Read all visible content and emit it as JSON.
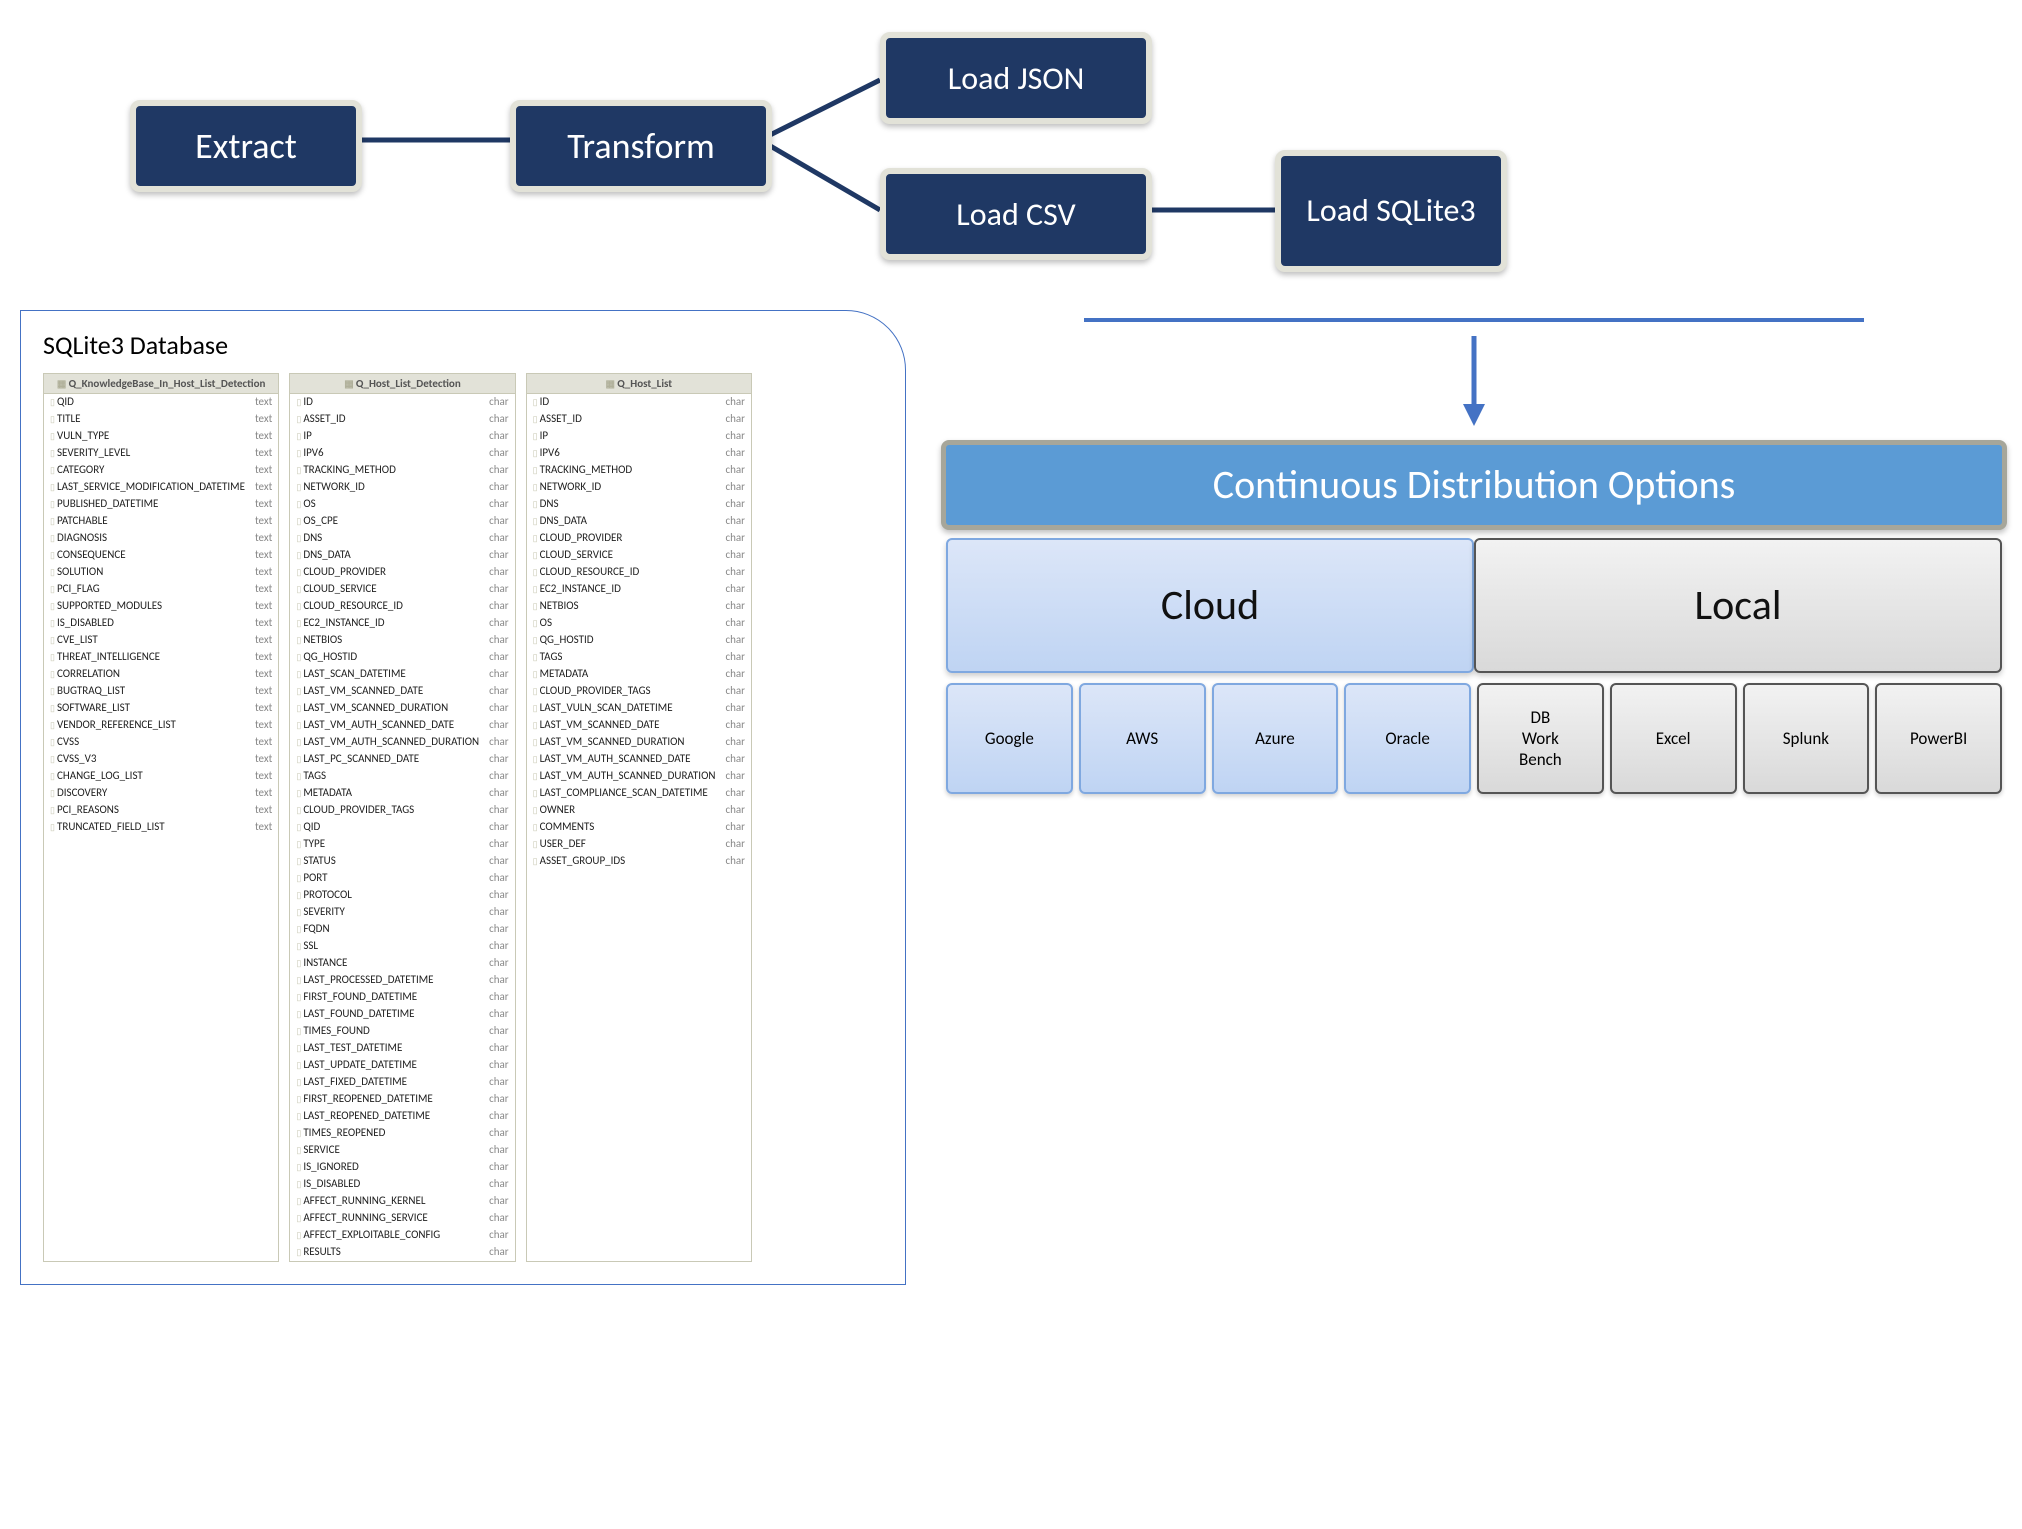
{
  "etl": {
    "extract": "Extract",
    "transform": "Transform",
    "load_json": "Load JSON",
    "load_csv": "Load CSV",
    "load_sqlite": "Load SQLite3"
  },
  "db_panel_title": "SQLite3 Database",
  "tables": [
    {
      "name": "Q_KnowledgeBase_In_Host_List_Detection",
      "fields": [
        {
          "n": "QID",
          "t": "text"
        },
        {
          "n": "TITLE",
          "t": "text"
        },
        {
          "n": "VULN_TYPE",
          "t": "text"
        },
        {
          "n": "SEVERITY_LEVEL",
          "t": "text"
        },
        {
          "n": "CATEGORY",
          "t": "text"
        },
        {
          "n": "LAST_SERVICE_MODIFICATION_DATETIME",
          "t": "text"
        },
        {
          "n": "PUBLISHED_DATETIME",
          "t": "text"
        },
        {
          "n": "PATCHABLE",
          "t": "text"
        },
        {
          "n": "DIAGNOSIS",
          "t": "text"
        },
        {
          "n": "CONSEQUENCE",
          "t": "text"
        },
        {
          "n": "SOLUTION",
          "t": "text"
        },
        {
          "n": "PCI_FLAG",
          "t": "text"
        },
        {
          "n": "SUPPORTED_MODULES",
          "t": "text"
        },
        {
          "n": "IS_DISABLED",
          "t": "text"
        },
        {
          "n": "CVE_LIST",
          "t": "text"
        },
        {
          "n": "THREAT_INTELLIGENCE",
          "t": "text"
        },
        {
          "n": "CORRELATION",
          "t": "text"
        },
        {
          "n": "BUGTRAQ_LIST",
          "t": "text"
        },
        {
          "n": "SOFTWARE_LIST",
          "t": "text"
        },
        {
          "n": "VENDOR_REFERENCE_LIST",
          "t": "text"
        },
        {
          "n": "CVSS",
          "t": "text"
        },
        {
          "n": "CVSS_V3",
          "t": "text"
        },
        {
          "n": "CHANGE_LOG_LIST",
          "t": "text"
        },
        {
          "n": "DISCOVERY",
          "t": "text"
        },
        {
          "n": "PCI_REASONS",
          "t": "text"
        },
        {
          "n": "TRUNCATED_FIELD_LIST",
          "t": "text"
        }
      ]
    },
    {
      "name": "Q_Host_List_Detection",
      "fields": [
        {
          "n": "ID",
          "t": "char"
        },
        {
          "n": "ASSET_ID",
          "t": "char"
        },
        {
          "n": "IP",
          "t": "char"
        },
        {
          "n": "IPV6",
          "t": "char"
        },
        {
          "n": "TRACKING_METHOD",
          "t": "char"
        },
        {
          "n": "NETWORK_ID",
          "t": "char"
        },
        {
          "n": "OS",
          "t": "char"
        },
        {
          "n": "OS_CPE",
          "t": "char"
        },
        {
          "n": "DNS",
          "t": "char"
        },
        {
          "n": "DNS_DATA",
          "t": "char"
        },
        {
          "n": "CLOUD_PROVIDER",
          "t": "char"
        },
        {
          "n": "CLOUD_SERVICE",
          "t": "char"
        },
        {
          "n": "CLOUD_RESOURCE_ID",
          "t": "char"
        },
        {
          "n": "EC2_INSTANCE_ID",
          "t": "char"
        },
        {
          "n": "NETBIOS",
          "t": "char"
        },
        {
          "n": "QG_HOSTID",
          "t": "char"
        },
        {
          "n": "LAST_SCAN_DATETIME",
          "t": "char"
        },
        {
          "n": "LAST_VM_SCANNED_DATE",
          "t": "char"
        },
        {
          "n": "LAST_VM_SCANNED_DURATION",
          "t": "char"
        },
        {
          "n": "LAST_VM_AUTH_SCANNED_DATE",
          "t": "char"
        },
        {
          "n": "LAST_VM_AUTH_SCANNED_DURATION",
          "t": "char"
        },
        {
          "n": "LAST_PC_SCANNED_DATE",
          "t": "char"
        },
        {
          "n": "TAGS",
          "t": "char"
        },
        {
          "n": "METADATA",
          "t": "char"
        },
        {
          "n": "CLOUD_PROVIDER_TAGS",
          "t": "char"
        },
        {
          "n": "QID",
          "t": "char"
        },
        {
          "n": "TYPE",
          "t": "char"
        },
        {
          "n": "STATUS",
          "t": "char"
        },
        {
          "n": "PORT",
          "t": "char"
        },
        {
          "n": "PROTOCOL",
          "t": "char"
        },
        {
          "n": "SEVERITY",
          "t": "char"
        },
        {
          "n": "FQDN",
          "t": "char"
        },
        {
          "n": "SSL",
          "t": "char"
        },
        {
          "n": "INSTANCE",
          "t": "char"
        },
        {
          "n": "LAST_PROCESSED_DATETIME",
          "t": "char"
        },
        {
          "n": "FIRST_FOUND_DATETIME",
          "t": "char"
        },
        {
          "n": "LAST_FOUND_DATETIME",
          "t": "char"
        },
        {
          "n": "TIMES_FOUND",
          "t": "char"
        },
        {
          "n": "LAST_TEST_DATETIME",
          "t": "char"
        },
        {
          "n": "LAST_UPDATE_DATETIME",
          "t": "char"
        },
        {
          "n": "LAST_FIXED_DATETIME",
          "t": "char"
        },
        {
          "n": "FIRST_REOPENED_DATETIME",
          "t": "char"
        },
        {
          "n": "LAST_REOPENED_DATETIME",
          "t": "char"
        },
        {
          "n": "TIMES_REOPENED",
          "t": "char"
        },
        {
          "n": "SERVICE",
          "t": "char"
        },
        {
          "n": "IS_IGNORED",
          "t": "char"
        },
        {
          "n": "IS_DISABLED",
          "t": "char"
        },
        {
          "n": "AFFECT_RUNNING_KERNEL",
          "t": "char"
        },
        {
          "n": "AFFECT_RUNNING_SERVICE",
          "t": "char"
        },
        {
          "n": "AFFECT_EXPLOITABLE_CONFIG",
          "t": "char"
        },
        {
          "n": "RESULTS",
          "t": "char"
        }
      ]
    },
    {
      "name": "Q_Host_List",
      "fields": [
        {
          "n": "ID",
          "t": "char"
        },
        {
          "n": "ASSET_ID",
          "t": "char"
        },
        {
          "n": "IP",
          "t": "char"
        },
        {
          "n": "IPV6",
          "t": "char"
        },
        {
          "n": "TRACKING_METHOD",
          "t": "char"
        },
        {
          "n": "NETWORK_ID",
          "t": "char"
        },
        {
          "n": "DNS",
          "t": "char"
        },
        {
          "n": "DNS_DATA",
          "t": "char"
        },
        {
          "n": "CLOUD_PROVIDER",
          "t": "char"
        },
        {
          "n": "CLOUD_SERVICE",
          "t": "char"
        },
        {
          "n": "CLOUD_RESOURCE_ID",
          "t": "char"
        },
        {
          "n": "EC2_INSTANCE_ID",
          "t": "char"
        },
        {
          "n": "NETBIOS",
          "t": "char"
        },
        {
          "n": "OS",
          "t": "char"
        },
        {
          "n": "QG_HOSTID",
          "t": "char"
        },
        {
          "n": "TAGS",
          "t": "char"
        },
        {
          "n": "METADATA",
          "t": "char"
        },
        {
          "n": "CLOUD_PROVIDER_TAGS",
          "t": "char"
        },
        {
          "n": "LAST_VULN_SCAN_DATETIME",
          "t": "char"
        },
        {
          "n": "LAST_VM_SCANNED_DATE",
          "t": "char"
        },
        {
          "n": "LAST_VM_SCANNED_DURATION",
          "t": "char"
        },
        {
          "n": "LAST_VM_AUTH_SCANNED_DATE",
          "t": "char"
        },
        {
          "n": "LAST_VM_AUTH_SCANNED_DURATION",
          "t": "char"
        },
        {
          "n": "LAST_COMPLIANCE_SCAN_DATETIME",
          "t": "char"
        },
        {
          "n": "OWNER",
          "t": "char"
        },
        {
          "n": "COMMENTS",
          "t": "char"
        },
        {
          "n": "USER_DEF",
          "t": "char"
        },
        {
          "n": "ASSET_GROUP_IDS",
          "t": "char"
        }
      ]
    }
  ],
  "distribution": {
    "title": "Continuous Distribution Options",
    "groups": {
      "cloud": "Cloud",
      "local": "Local"
    },
    "cloud_chips": [
      "Google",
      "AWS",
      "Azure",
      "Oracle"
    ],
    "local_chips": [
      "DB Work Bench",
      "Excel",
      "Splunk",
      "PowerBI"
    ]
  }
}
